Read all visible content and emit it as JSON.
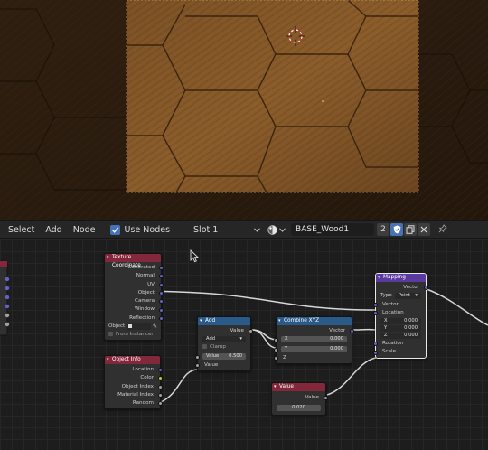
{
  "header": {
    "menus": [
      "Select",
      "Add",
      "Node"
    ],
    "use_nodes_label": "Use Nodes",
    "slot_label": "Slot 1",
    "material_name": "BASE_Wood1",
    "users_count": "2"
  },
  "nodes": {
    "texcoord": {
      "title": "Texture Coordinate",
      "outputs": [
        "Generated",
        "Normal",
        "UV",
        "Object",
        "Camera",
        "Window",
        "Reflection"
      ],
      "object_label": "Object",
      "instancer_label": "From Instancer"
    },
    "objinfo": {
      "title": "Object Info",
      "outputs": [
        "Location",
        "Color",
        "Object Index",
        "Material Index",
        "Random"
      ]
    },
    "add": {
      "title": "Add",
      "output": "Value",
      "operation": "Add",
      "clamp_label": "Clamp",
      "value_label": "Value",
      "value": "0.500",
      "input": "Value"
    },
    "combine": {
      "title": "Combine XYZ",
      "output": "Vector",
      "x_label": "X",
      "x_value": "0.000",
      "y_label": "Y",
      "y_value": "0.000",
      "z_label": "Z"
    },
    "value": {
      "title": "Value",
      "output": "Value",
      "value": "0.020"
    },
    "mapping": {
      "title": "Mapping",
      "output": "Vector",
      "type_label": "Type",
      "type_value": "Point",
      "vector_label": "Vector",
      "location_label": "Location",
      "loc_x_label": "X",
      "loc_x": "0.000",
      "loc_y_label": "Y",
      "loc_y": "0.000",
      "loc_z_label": "Z",
      "loc_z": "0.000",
      "rotation_label": "Rotation",
      "scale_label": "Scale"
    }
  },
  "colors": {
    "accent": "#4772b3",
    "input_header": "#82283a",
    "converter_header": "#2a5a8a",
    "vector_header": "#5b3aa0",
    "socket_vector": "#6363c7",
    "socket_color": "#c7c729",
    "socket_float": "#a1a1a1"
  }
}
